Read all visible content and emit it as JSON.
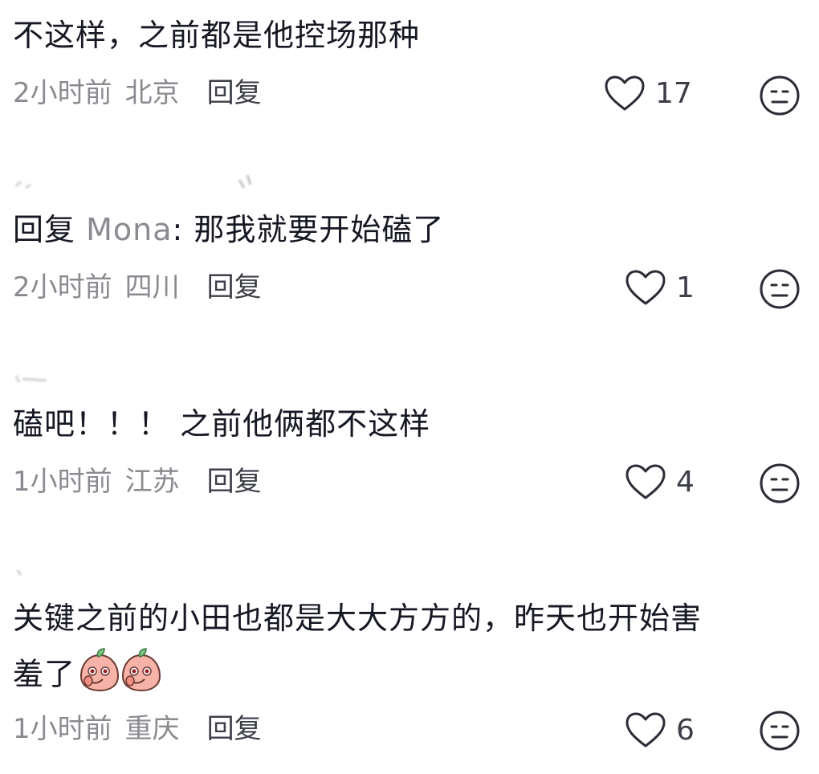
{
  "comments": [
    {
      "username": "",
      "text": "不这样，之前都是他控场那种",
      "time": "2小时前",
      "location": "北京",
      "reply_label": "回复",
      "likes": "17"
    },
    {
      "username": "",
      "reply_prefix": "回复 ",
      "mention": "Mona",
      "text": ": 那我就要开始磕了",
      "time": "2小时前",
      "location": "四川",
      "reply_label": "回复",
      "likes": "1"
    },
    {
      "username": "",
      "text": "磕吧！！！ 之前他俩都不这样",
      "time": "1小时前",
      "location": "江苏",
      "reply_label": "回复",
      "likes": "4"
    },
    {
      "username": "",
      "text_line1": "关键之前的小田也都是大大方方的，昨天也开始害",
      "text_line2": "羞了",
      "emojis": [
        "shy-peach-emoji",
        "shy-peach-emoji"
      ],
      "time": "1小时前",
      "location": "重庆",
      "reply_label": "回复",
      "likes": "6"
    }
  ],
  "icons": {
    "like": "heart-outline-icon",
    "dislike": "neutral-face-icon"
  },
  "colors": {
    "text": "#161823",
    "meta": "#8a8b91",
    "mention": "#8a8b91",
    "icon": "#2b2d36",
    "emoji_peach": "#f7b3a8"
  }
}
